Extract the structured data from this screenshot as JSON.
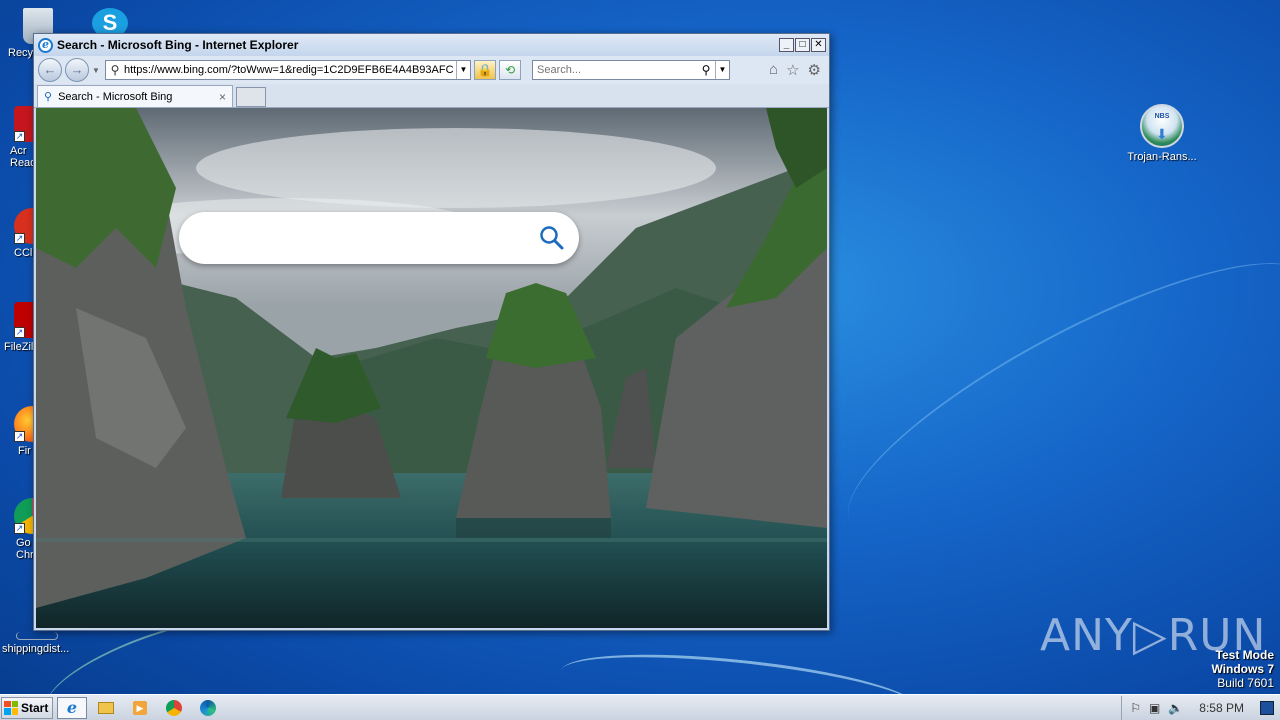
{
  "desktop": {
    "icons": [
      {
        "label": "Recy",
        "icon": "recycle-bin-icon"
      },
      {
        "label": "Acr Read",
        "icon": "acrobat-reader-icon"
      },
      {
        "label": "CCl",
        "icon": "ccleaner-icon"
      },
      {
        "label": "FileZil",
        "icon": "filezilla-icon"
      },
      {
        "label": "Fir",
        "icon": "firefox-icon"
      },
      {
        "label": "Go Chr",
        "icon": "chrome-icon"
      },
      {
        "label": "shippingdist...",
        "icon": "file-icon"
      },
      {
        "label": "Trojan-Rans...",
        "icon": "nbs-file-icon"
      }
    ],
    "skype_icon": "skype-icon"
  },
  "ie": {
    "title": "Search - Microsoft Bing - Internet Explorer",
    "window_buttons": {
      "minimize": "_",
      "maximize": "□",
      "close": "✕"
    },
    "address": "https://www.bing.com/?toWww=1&redig=1C2D9EFB6E4A4B93AFC",
    "search_placeholder": "Search...",
    "tab_label": "Search - Microsoft Bing",
    "tab_close": "×"
  },
  "bing": {
    "search_value": ""
  },
  "watermark": {
    "brand": "ANY▷RUN",
    "line1": "Test Mode",
    "line2": "Windows 7",
    "line3": "Build 7601"
  },
  "taskbar": {
    "start_label": "Start",
    "clock": "8:58 PM",
    "apps": [
      "internet-explorer-icon",
      "file-explorer-icon",
      "media-player-icon",
      "chrome-icon",
      "edge-icon"
    ]
  },
  "colors": {
    "desktop_blue": "#1565c8",
    "ie_accent": "#1a78d0",
    "bing_accent": "#1c6bbf"
  }
}
